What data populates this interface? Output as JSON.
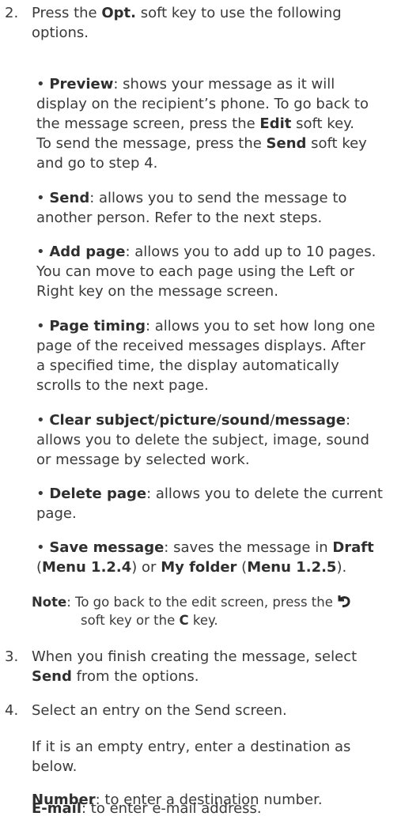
{
  "step2": {
    "number": "2.",
    "intro_a": "Press the ",
    "intro_key": "Opt.",
    "intro_b": " soft key to use the following",
    "intro_c": "options."
  },
  "bullets": {
    "preview": {
      "term": "Preview",
      "l1": ": shows your message as it will",
      "l2": "display on the recipient’s phone. To go back to",
      "l3a": "the message screen, press the ",
      "l3k": "Edit",
      "l3b": " soft key.",
      "l4a": "To send the message, press the ",
      "l4k": "Send",
      "l4b": " soft key",
      "l5": "and go to step 4."
    },
    "send": {
      "term": "Send",
      "l1": ": allows you to send the message to",
      "l2": "another person. Refer to the next steps."
    },
    "add_page": {
      "term": "Add page",
      "l1": ": allows you to add up to 10 pages.",
      "l2": "You can move to each page using the Left or",
      "l3": "Right key on the message screen."
    },
    "page_timing": {
      "term": "Page timing",
      "l1": ": allows you to set how long one",
      "l2": "page of the received messages displays. After",
      "l3": "a specified time, the display automatically",
      "l4": "scrolls to the next page."
    },
    "clear": {
      "t1": "Clear subject",
      "s1": "/",
      "t2": "picture",
      "s2": "/",
      "t3": "sound",
      "s3": "/",
      "t4": "message",
      "colon": ":",
      "l2": "allows you to delete the subject, image, sound",
      "l3": "or message by selected work."
    },
    "delete_page": {
      "term": "Delete page",
      "l1": ": allows you to delete the current",
      "l2": "page."
    },
    "save_message": {
      "term": "Save message",
      "l1a": ": saves the message in ",
      "l1k": "Draft",
      "l2a": "(",
      "l2k1": "Menu 1.2.4",
      "l2b": ") or ",
      "l2k2": "My folder",
      "l2c": " (",
      "l2k3": "Menu 1.2.5",
      "l2d": ")."
    }
  },
  "note": {
    "label": "Note",
    "l1a": ": To go back to the edit screen, press the ",
    "icon": "back-arrow-icon",
    "l2a": "soft key or the ",
    "l2k": "C",
    "l2b": " key."
  },
  "step3": {
    "number": "3.",
    "l1": "When you finish creating the message, select",
    "l2k": "Send",
    "l2b": " from the options."
  },
  "step4": {
    "number": "4.",
    "l1": "Select an entry on the Send screen.",
    "p1l1": "If it is an empty entry, enter a destination as",
    "p1l2": "below.",
    "number_term": "Number",
    "number_text": ": to enter a destination number.",
    "email_term": "E-mail",
    "email_text": ": to enter e-mail address."
  }
}
